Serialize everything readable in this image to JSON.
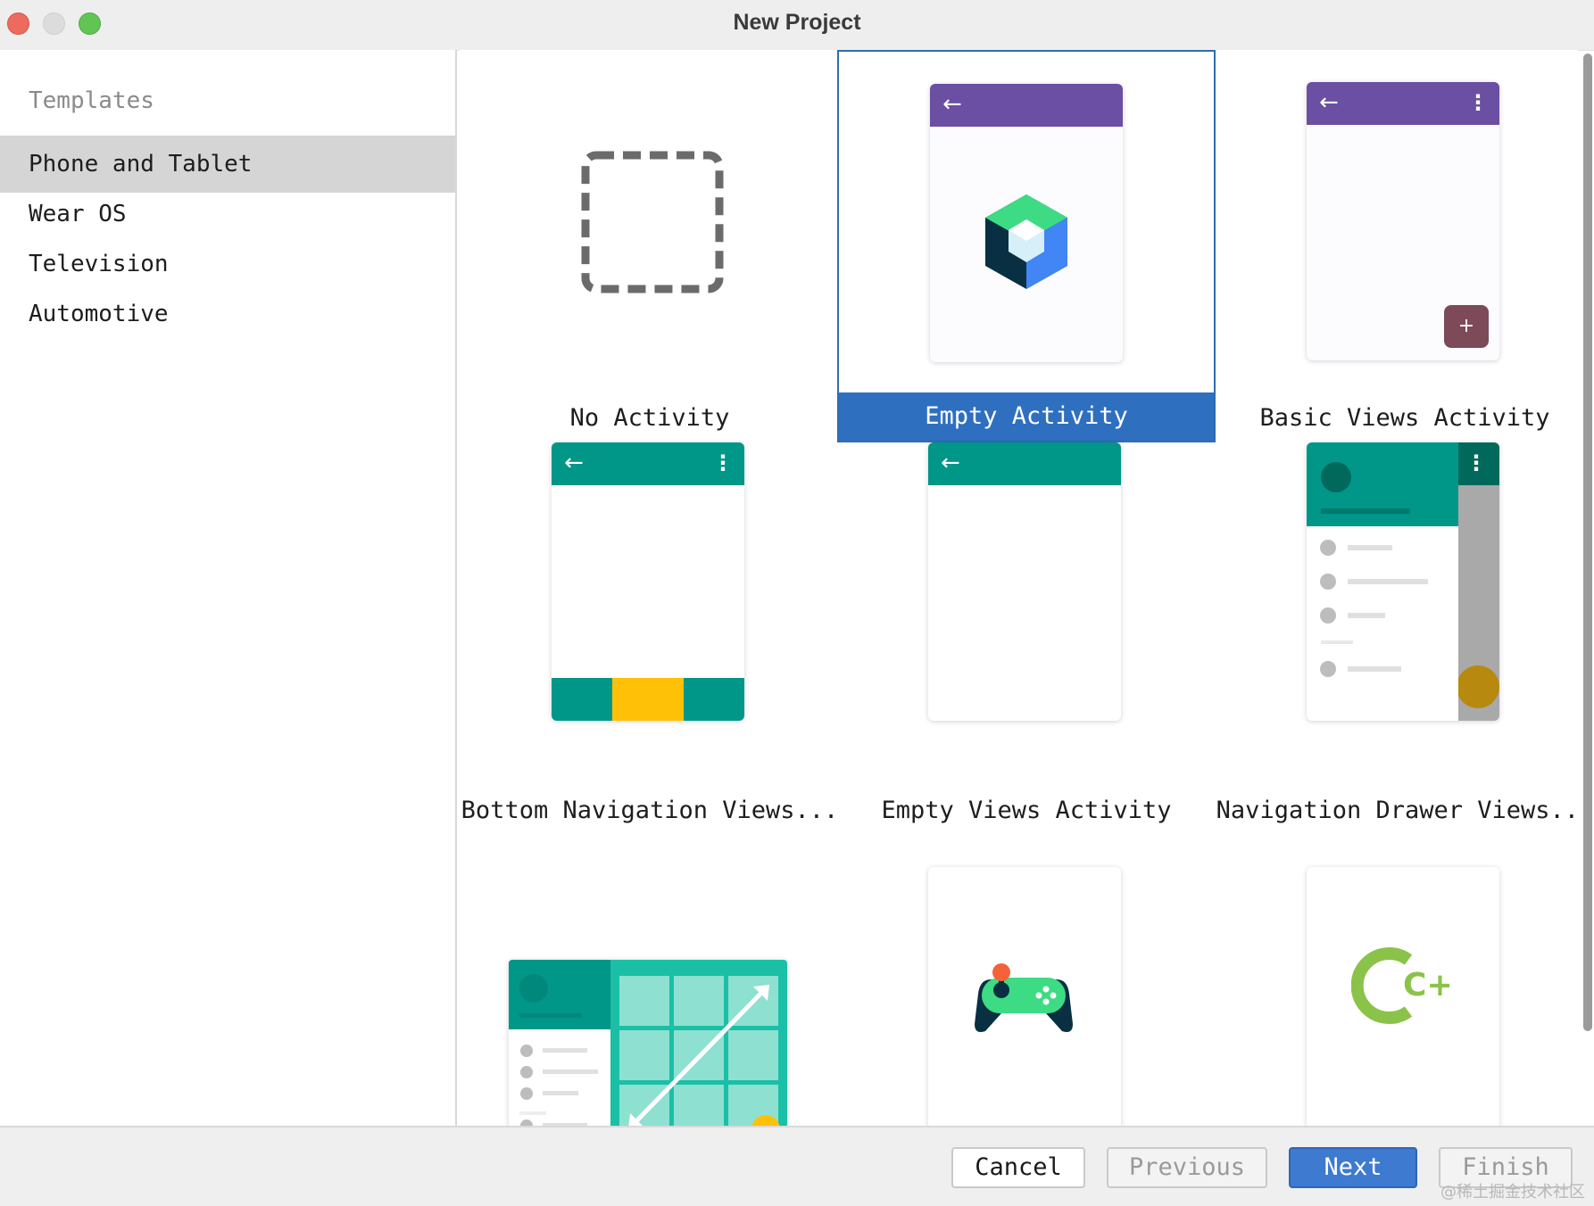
{
  "window": {
    "title": "New Project"
  },
  "sidebar": {
    "header": "Templates",
    "items": [
      {
        "label": "Phone and Tablet",
        "selected": true
      },
      {
        "label": "Wear OS"
      },
      {
        "label": "Television"
      },
      {
        "label": "Automotive"
      }
    ]
  },
  "templates": [
    {
      "label": "No Activity",
      "icon": "dashed-square-icon"
    },
    {
      "label": "Empty Activity",
      "icon": "jetpack-compose-icon",
      "selected": true
    },
    {
      "label": "Basic Views Activity",
      "icon": "phone-fab-icon"
    },
    {
      "label": "Bottom Navigation Views...",
      "icon": "bottom-nav-phone-icon"
    },
    {
      "label": "Empty Views Activity",
      "icon": "empty-phone-icon"
    },
    {
      "label": "Navigation Drawer Views...",
      "icon": "nav-drawer-phone-icon"
    },
    {
      "label": "",
      "icon": "responsive-layout-icon"
    },
    {
      "label": "",
      "icon": "game-controller-icon"
    },
    {
      "label": "",
      "icon": "cpp-icon",
      "text": "C++"
    }
  ],
  "colors": {
    "purple_bar": "#6a4fa3",
    "teal_bar": "#009688",
    "selected_blue": "#2f6fc0",
    "fab_maroon": "#7d4a5a",
    "yellow": "#ffc107"
  },
  "footer": {
    "cancel": "Cancel",
    "previous": "Previous",
    "next": "Next",
    "finish": "Finish"
  },
  "watermark": "@稀土掘金技术社区"
}
